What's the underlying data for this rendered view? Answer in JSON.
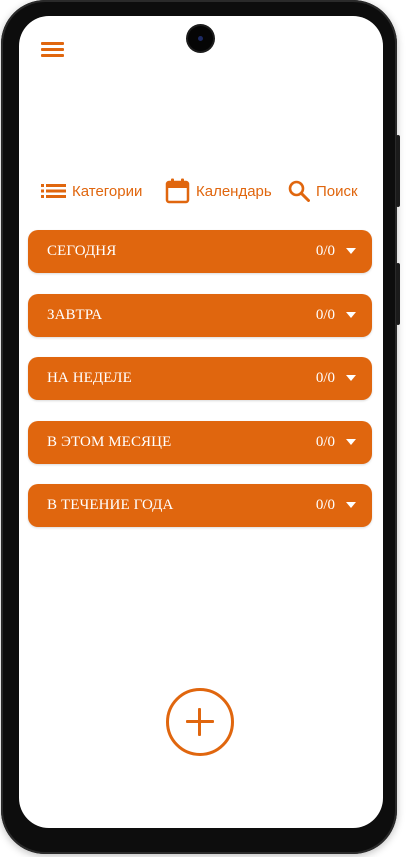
{
  "colors": {
    "accent": "#e0660e",
    "on_accent": "#ffffff",
    "frame": "#0d0d0d",
    "screen_bg": "#ffffff"
  },
  "header": {
    "menu_icon": "hamburger-menu-icon"
  },
  "toolbar": {
    "categories": {
      "label": "Категории",
      "icon": "list-icon"
    },
    "calendar": {
      "label": "Календарь",
      "icon": "calendar-icon"
    },
    "search": {
      "label": "Поиск",
      "icon": "search-icon"
    }
  },
  "sections": [
    {
      "title": "СЕГОДНЯ",
      "count": "0/0",
      "icon": "caret-down-icon"
    },
    {
      "title": "ЗАВТРА",
      "count": "0/0",
      "icon": "caret-down-icon"
    },
    {
      "title": "НА НЕДЕЛЕ",
      "count": "0/0",
      "icon": "caret-down-icon"
    },
    {
      "title": "В ЭТОМ МЕСЯЦЕ",
      "count": "0/0",
      "icon": "caret-down-icon"
    },
    {
      "title": "В ТЕЧЕНИЕ ГОДА",
      "count": "0/0",
      "icon": "caret-down-icon"
    }
  ],
  "fab": {
    "icon": "plus-icon"
  }
}
